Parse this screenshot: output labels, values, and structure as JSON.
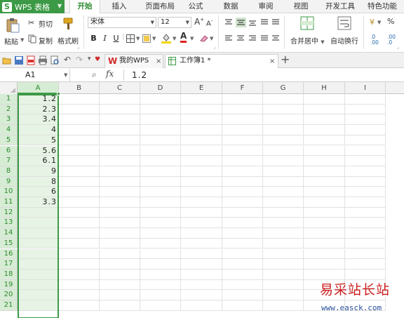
{
  "app": {
    "name": "WPS 表格",
    "logo": "S"
  },
  "menu": {
    "tabs": [
      "开始",
      "插入",
      "页面布局",
      "公式",
      "数据",
      "审阅",
      "视图",
      "开发工具",
      "特色功能"
    ],
    "active": "开始"
  },
  "ribbon": {
    "paste": "粘贴",
    "cut": "剪切",
    "copy": "复制",
    "format_painter": "格式刷",
    "font_name": "宋体",
    "font_size": "12",
    "merge_center": "合并居中",
    "wrap_text": "自动换行",
    "percent": "%",
    "bold": "B",
    "italic": "I",
    "underline": "U",
    "font_color_letter": "A",
    "grow_font": "A",
    "shrink_font": "A"
  },
  "tabs": [
    {
      "label": "我的WPS",
      "icon": "wps-logo-icon"
    },
    {
      "label": "工作簿1 *",
      "icon": "spreadsheet-icon",
      "active": true
    }
  ],
  "formula_bar": {
    "name_box": "A1",
    "fx": "fx",
    "value": "1.2"
  },
  "sheet": {
    "columns": [
      "A",
      "B",
      "C",
      "D",
      "E",
      "F",
      "G",
      "H",
      "I"
    ],
    "rows": [
      "1",
      "2",
      "3",
      "4",
      "5",
      "6",
      "7",
      "8",
      "9",
      "10",
      "11",
      "12",
      "13",
      "14",
      "15",
      "16",
      "17",
      "18",
      "19",
      "20",
      "21"
    ],
    "column_a": [
      "1.2",
      "2.3",
      "3.4",
      "4",
      "5",
      "5.6",
      "6.1",
      "9",
      "8",
      "6",
      "3.3",
      "",
      "",
      "",
      "",
      "",
      "",
      "",
      "",
      "",
      ""
    ],
    "selected_column": "A",
    "selected_rows": 21
  },
  "watermark": {
    "text": "易采站长站",
    "url": "www.easck.com"
  },
  "colors": {
    "accent": "#3c9a46",
    "selection_fill": "#e7f3e4",
    "watermark_red": "#cc1f1f"
  }
}
